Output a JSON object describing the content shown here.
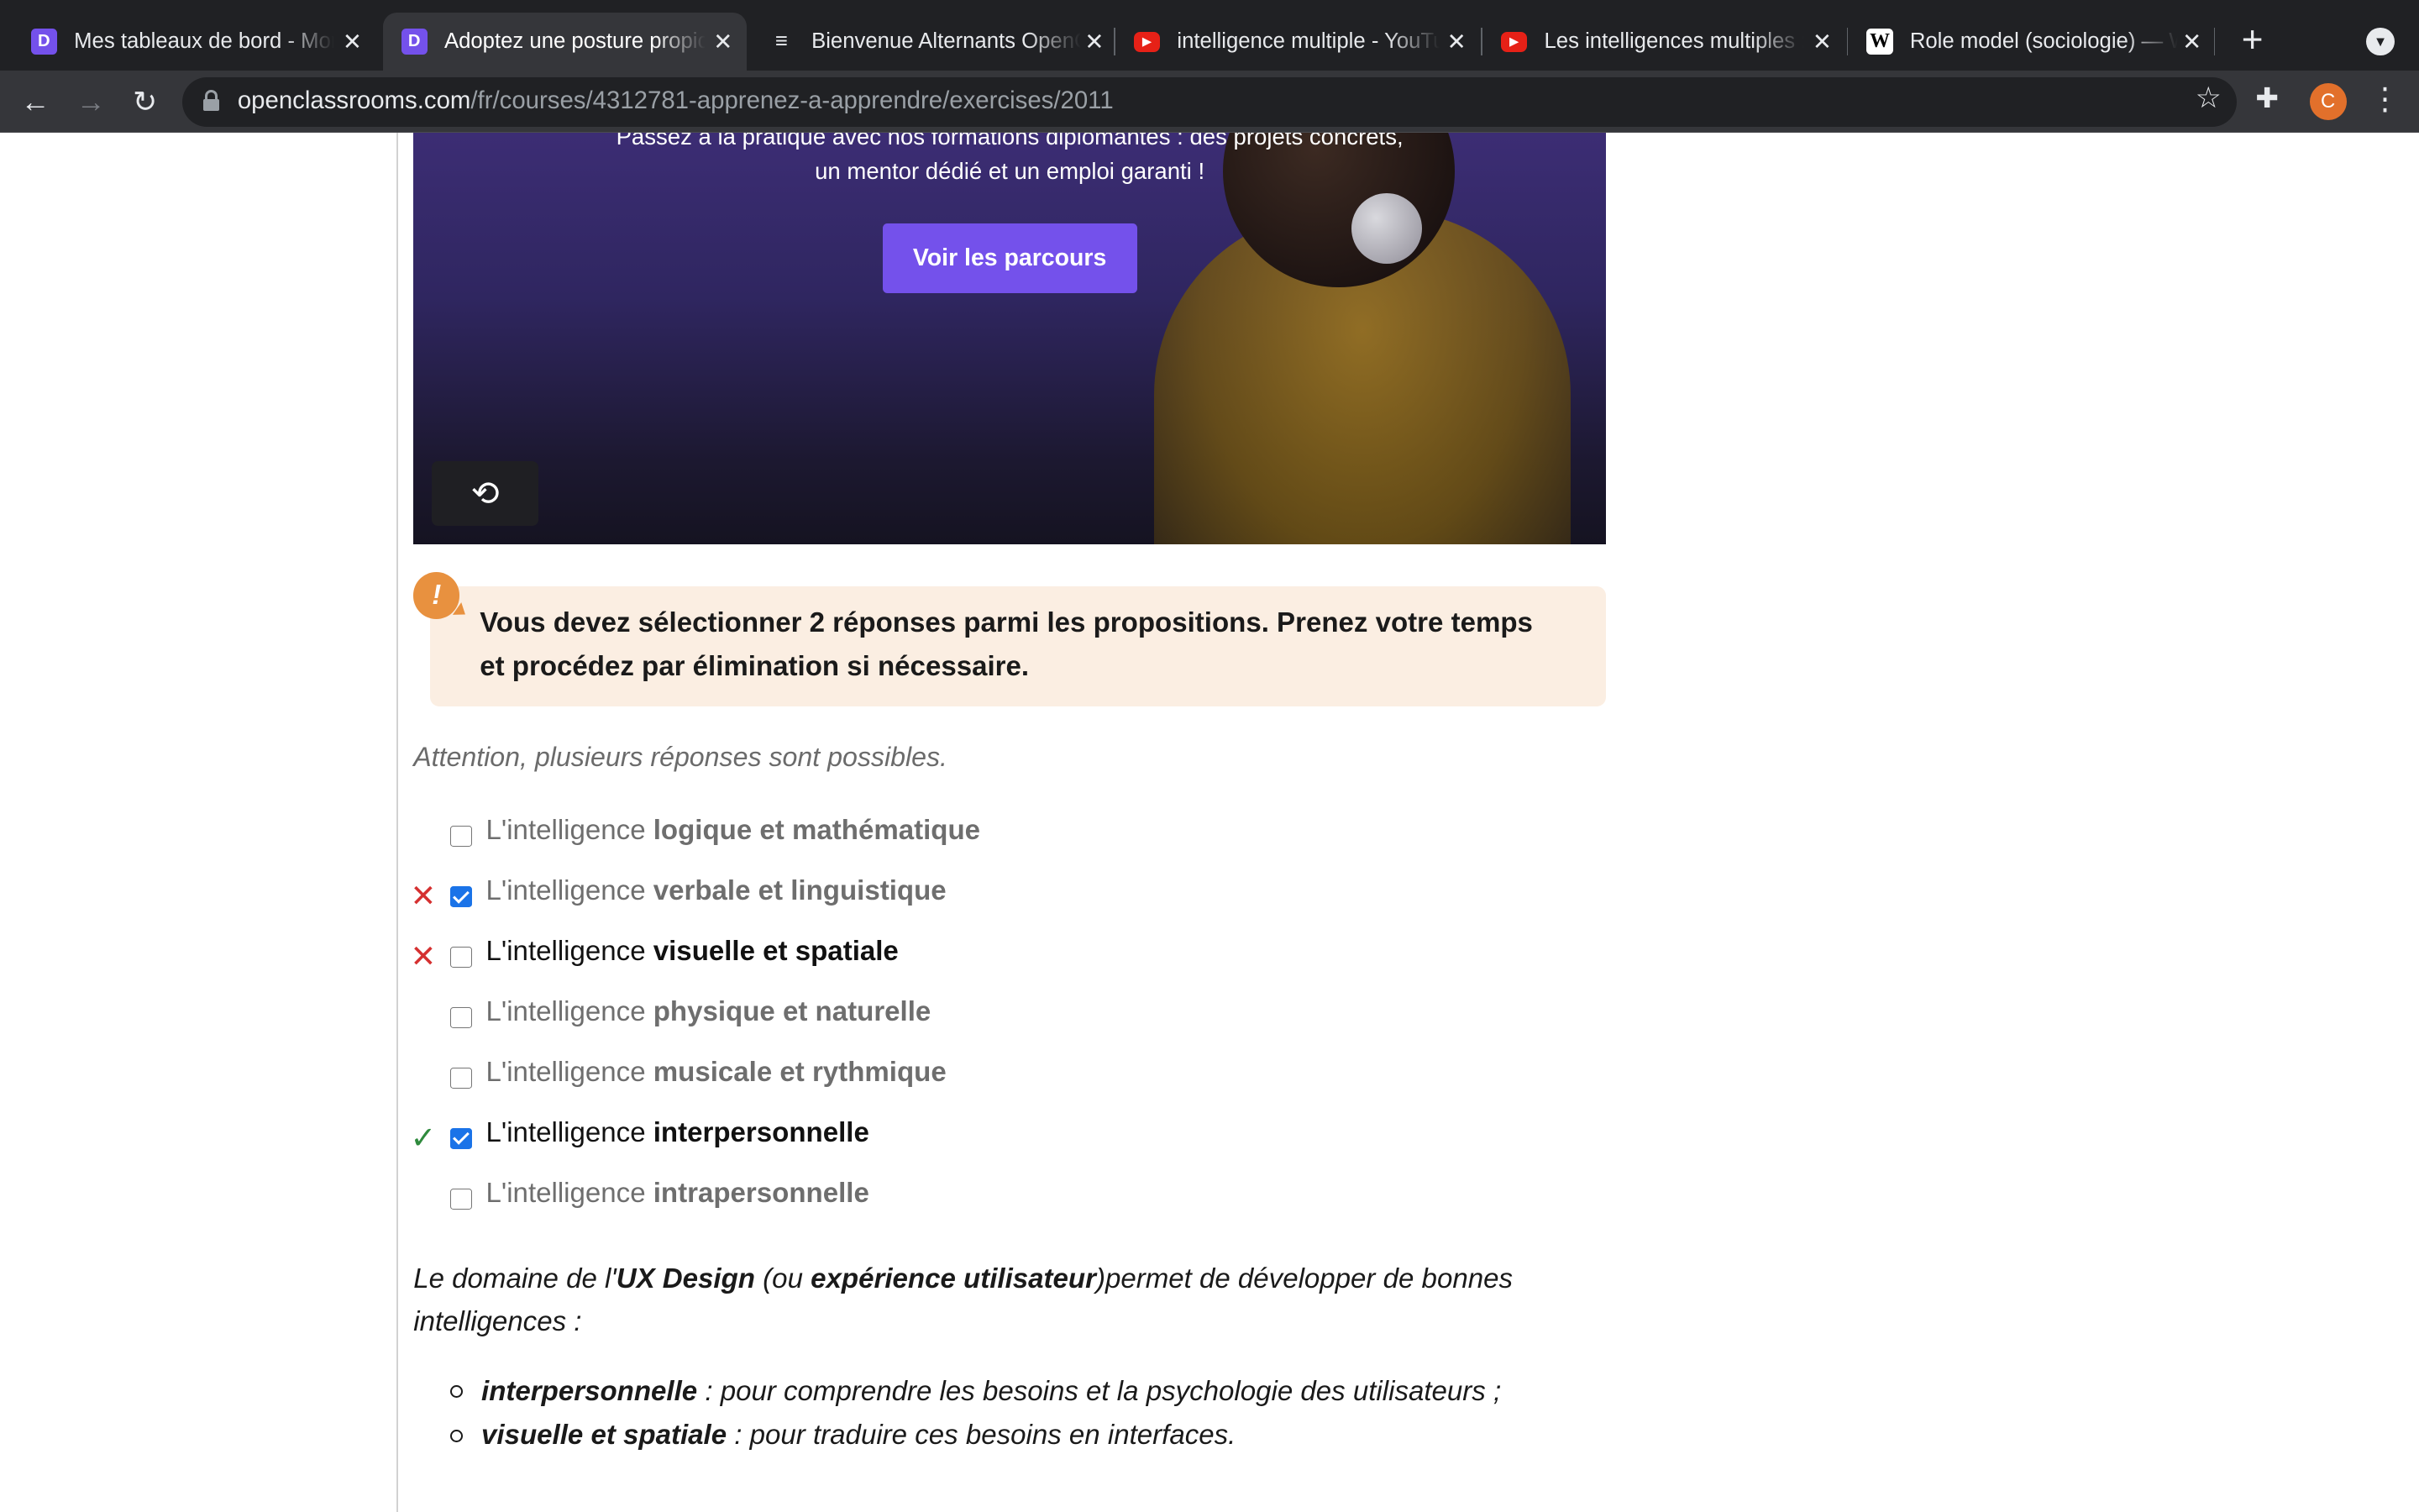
{
  "browser": {
    "tabs": [
      {
        "title": "Mes tableaux de bord - Mon",
        "favicon": "openclassrooms-icon",
        "active": false
      },
      {
        "title": "Adoptez une posture propice",
        "favicon": "openclassrooms-icon",
        "active": true
      },
      {
        "title": "Bienvenue Alternants OpenClassrooms",
        "favicon": "filter-icon",
        "active": false
      },
      {
        "title": "intelligence multiple - YouTube",
        "favicon": "youtube-icon",
        "active": false
      },
      {
        "title": "Les intelligences multiples : ",
        "favicon": "youtube-icon",
        "active": false
      },
      {
        "title": "Role model (sociologie) — Wikipédia",
        "favicon": "wikipedia-icon",
        "active": false
      }
    ],
    "close_glyph": "✕",
    "new_tab_glyph": "+",
    "url_host": "openclassrooms.com",
    "url_path": "/fr/courses/4312781-apprenez-a-apprendre/exercises/2011",
    "profile_initial": "C",
    "colors": {
      "tabstrip": "#202124",
      "toolbar": "#35363a",
      "profile": "#e2702b"
    }
  },
  "promo": {
    "line1": "Passez à la pratique avec nos formations diplômantes : des projets concrets,",
    "line2": "un mentor dédié et un emploi garanti !",
    "cta_label": "Voir les parcours",
    "cta_color": "#7451eb",
    "replay_icon": "replay-icon"
  },
  "alert": {
    "icon_glyph": "!",
    "text": "Vous devez sélectionner 2 réponses parmi les propositions. Prenez votre temps et procédez par élimination si nécessaire."
  },
  "quiz": {
    "hint": "Attention, plusieurs réponses sont possibles.",
    "prefix": "L'intelligence ",
    "options": [
      {
        "bold": "logique et mathématique",
        "checked": false,
        "result": "",
        "dark": false
      },
      {
        "bold": "verbale et linguistique",
        "checked": true,
        "result": "wrong",
        "dark": false
      },
      {
        "bold": "visuelle et spatiale",
        "checked": false,
        "result": "wrong",
        "dark": true
      },
      {
        "bold": "physique et naturelle",
        "checked": false,
        "result": "",
        "dark": false
      },
      {
        "bold": "musicale et rythmique",
        "checked": false,
        "result": "",
        "dark": false
      },
      {
        "bold": "interpersonnelle",
        "checked": true,
        "result": "right",
        "dark": true
      },
      {
        "bold": "intrapersonnelle",
        "checked": false,
        "result": "",
        "dark": false
      }
    ],
    "marks": {
      "wrong": "✕",
      "right": "✓"
    }
  },
  "explanation": {
    "p1": "Le domaine de l'",
    "b1": "UX Design",
    "p2": " (ou ",
    "b2": "expérience utilisateur",
    "p3": ")permet de développer de bonnes intelligences :",
    "bullets": [
      {
        "bold": "interpersonnelle",
        "text": " : pour comprendre les besoins et la psychologie des utilisateurs ;"
      },
      {
        "bold": "visuelle et spatiale",
        "text": " : pour traduire ces besoins en interfaces."
      }
    ]
  }
}
